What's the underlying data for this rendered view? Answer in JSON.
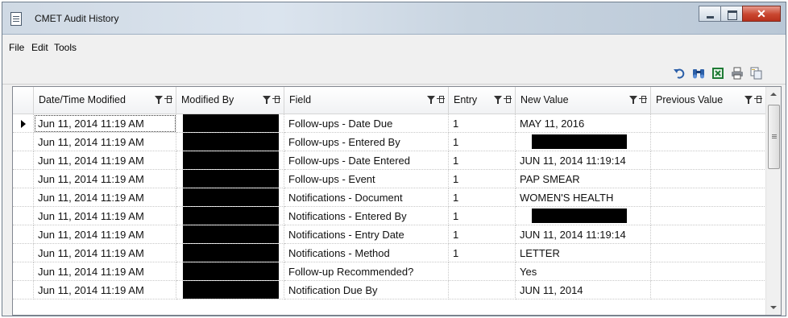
{
  "window": {
    "title": "CMET Audit History"
  },
  "menu": {
    "items": [
      "File",
      "Edit",
      "Tools"
    ]
  },
  "toolbar": {
    "icons": [
      "undo-icon",
      "find-icon",
      "excel-export-icon",
      "print-icon",
      "copy-icon"
    ]
  },
  "grid": {
    "columns": [
      "Date/Time Modified",
      "Modified By",
      "Field",
      "Entry",
      "New Value",
      "Previous Value"
    ],
    "rows": [
      {
        "date": "Jun 11, 2014 11:19 AM",
        "field": "Follow-ups - Date Due",
        "entry": "1",
        "new_value": "MAY 11, 2016",
        "previous": ""
      },
      {
        "date": "Jun 11, 2014 11:19 AM",
        "field": "Follow-ups - Entered By",
        "entry": "1",
        "new_value": "",
        "previous": ""
      },
      {
        "date": "Jun 11, 2014 11:19 AM",
        "field": "Follow-ups - Date Entered",
        "entry": "1",
        "new_value": "JUN 11, 2014 11:19:14",
        "previous": ""
      },
      {
        "date": "Jun 11, 2014 11:19 AM",
        "field": "Follow-ups - Event",
        "entry": "1",
        "new_value": "PAP SMEAR",
        "previous": ""
      },
      {
        "date": "Jun 11, 2014 11:19 AM",
        "field": "Notifications - Document",
        "entry": "1",
        "new_value": "WOMEN'S HEALTH",
        "previous": ""
      },
      {
        "date": "Jun 11, 2014 11:19 AM",
        "field": "Notifications - Entered By",
        "entry": "1",
        "new_value": "",
        "previous": ""
      },
      {
        "date": "Jun 11, 2014 11:19 AM",
        "field": "Notifications - Entry Date",
        "entry": "1",
        "new_value": "JUN 11, 2014 11:19:14",
        "previous": ""
      },
      {
        "date": "Jun 11, 2014 11:19 AM",
        "field": "Notifications - Method",
        "entry": "1",
        "new_value": "LETTER",
        "previous": ""
      },
      {
        "date": "Jun 11, 2014 11:19 AM",
        "field": "Follow-up Recommended?",
        "entry": "",
        "new_value": "Yes",
        "previous": ""
      },
      {
        "date": "Jun 11, 2014 11:19 AM",
        "field": "Notification Due By",
        "entry": "",
        "new_value": "JUN 11, 2014",
        "previous": ""
      }
    ]
  },
  "colors": {
    "excel_green": "#1e7b34",
    "find_icon": "#2b5fa8",
    "redaction": "#000000"
  }
}
